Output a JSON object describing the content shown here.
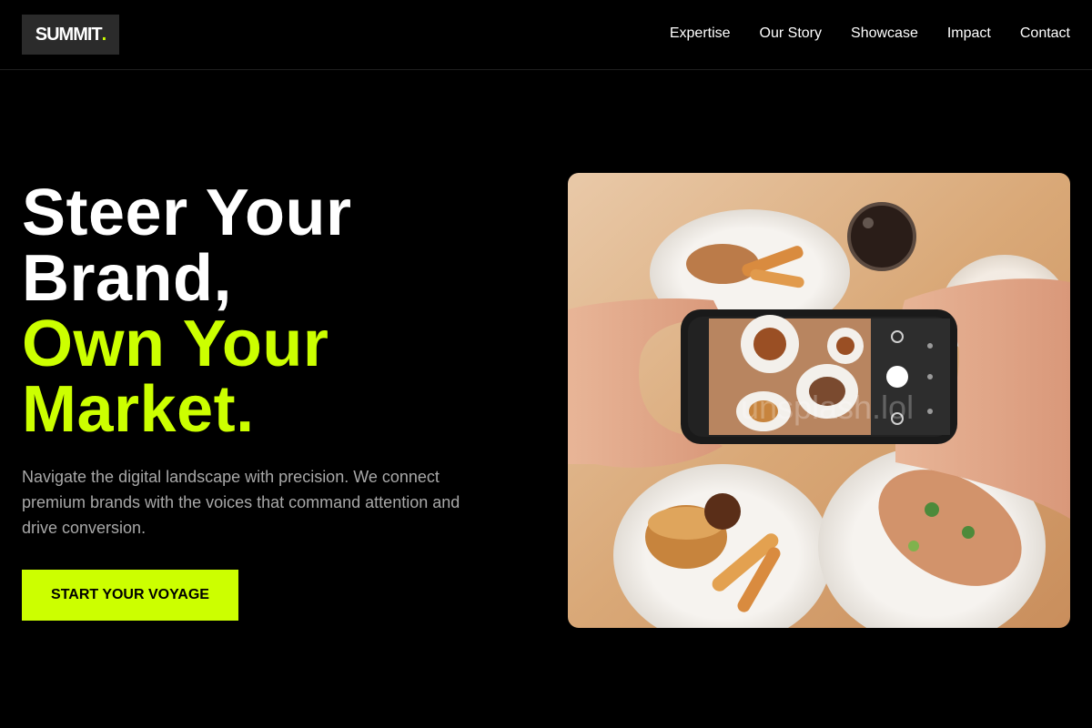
{
  "brand": {
    "logo_text": "SUMMIT",
    "logo_dot": "."
  },
  "nav": {
    "items": [
      {
        "label": "Expertise"
      },
      {
        "label": "Our Story"
      },
      {
        "label": "Showcase"
      },
      {
        "label": "Impact"
      },
      {
        "label": "Contact"
      }
    ]
  },
  "hero": {
    "headline_line1": "Steer Your",
    "headline_line2": "Brand,",
    "headline_accent_line1": "Own Your",
    "headline_accent_line2": "Market.",
    "description": "Navigate the digital landscape with precision. We connect premium brands with the voices that command attention and drive conversion.",
    "cta_label": "START YOUR VOYAGE",
    "image_subject": "hands-holding-phone-photographing-food-photo",
    "image_watermark": "unsplash.lol"
  },
  "colors": {
    "background": "#000000",
    "accent": "#ccff00",
    "text": "#ffffff",
    "muted": "#a8a8a8",
    "logo_bg": "#2b2b2b"
  }
}
